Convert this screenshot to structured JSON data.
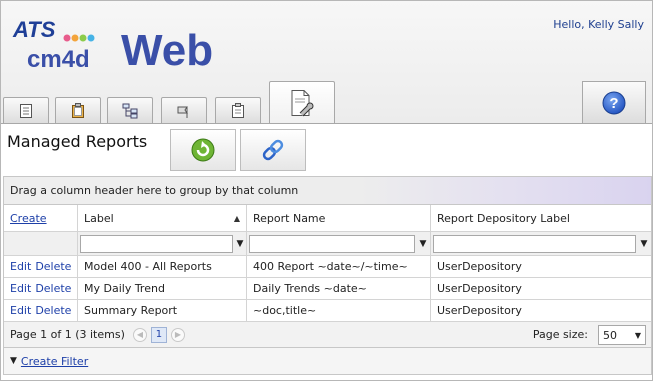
{
  "header": {
    "logo_top": "ATS",
    "logo_mid": "cm4d",
    "logo_main": "Web",
    "greeting": "Hello, Kelly Sally"
  },
  "toolbar": {
    "tabs": [
      {
        "icon": "document-icon"
      },
      {
        "icon": "clipboard-icon"
      },
      {
        "icon": "hierarchy-icon"
      },
      {
        "icon": "flag-icon"
      },
      {
        "icon": "clipboard-list-icon"
      },
      {
        "icon": "report-settings-icon"
      }
    ],
    "help_icon": "help-icon",
    "help_glyph": "?"
  },
  "page": {
    "title": "Managed Reports",
    "refresh_icon": "refresh-icon",
    "link_icon": "link-icon"
  },
  "grid": {
    "group_panel_text": "Drag a column header here to group by that column",
    "columns": {
      "command": "Create",
      "label": "Label",
      "report_name": "Report Name",
      "depository": "Report Depository Label"
    },
    "sort": {
      "column": "Label",
      "direction": "ascending",
      "glyph": "▲"
    },
    "filter_glyph": "▼",
    "edit_label": "Edit",
    "delete_label": "Delete",
    "rows": [
      {
        "label": "Model 400 - All Reports",
        "report_name": "400 Report ~date~/~time~",
        "depository": "UserDepository"
      },
      {
        "label": "My Daily Trend",
        "report_name": "Daily Trends ~date~",
        "depository": "UserDepository"
      },
      {
        "label": "Summary Report",
        "report_name": "~doc,title~",
        "depository": "UserDepository"
      }
    ]
  },
  "pager": {
    "summary": "Page 1 of 1 (3 items)",
    "prev_glyph": "◀",
    "next_glyph": "▶",
    "current_page": "1",
    "page_size_label": "Page size:",
    "page_size_value": "50",
    "caret": "▼"
  },
  "footer": {
    "filter_glyph": "▼",
    "create_filter": "Create Filter"
  }
}
